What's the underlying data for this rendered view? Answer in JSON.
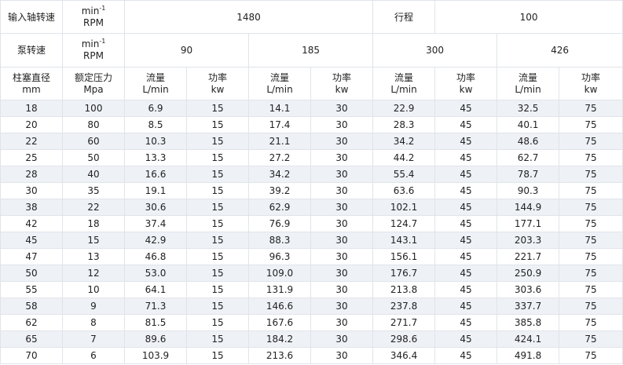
{
  "header": {
    "input_speed_label": "输入轴转速",
    "unit_min": "min",
    "unit_exp": "-1",
    "unit_rpm": "RPM",
    "input_speed_value": "1480",
    "stroke_label": "行程",
    "stroke_value": "100",
    "pump_speed_label": "泵转速",
    "pump_speeds": [
      "90",
      "185",
      "300",
      "426"
    ],
    "plunger_label": "柱塞直径",
    "plunger_unit": "mm",
    "pressure_label": "额定压力",
    "pressure_unit": "Mpa",
    "flow_label": "流量",
    "flow_unit": "L/min",
    "power_label": "功率",
    "power_unit": "kw"
  },
  "rows": [
    [
      "18",
      "100",
      "6.9",
      "15",
      "14.1",
      "30",
      "22.9",
      "45",
      "32.5",
      "75"
    ],
    [
      "20",
      "80",
      "8.5",
      "15",
      "17.4",
      "30",
      "28.3",
      "45",
      "40.1",
      "75"
    ],
    [
      "22",
      "60",
      "10.3",
      "15",
      "21.1",
      "30",
      "34.2",
      "45",
      "48.6",
      "75"
    ],
    [
      "25",
      "50",
      "13.3",
      "15",
      "27.2",
      "30",
      "44.2",
      "45",
      "62.7",
      "75"
    ],
    [
      "28",
      "40",
      "16.6",
      "15",
      "34.2",
      "30",
      "55.4",
      "45",
      "78.7",
      "75"
    ],
    [
      "30",
      "35",
      "19.1",
      "15",
      "39.2",
      "30",
      "63.6",
      "45",
      "90.3",
      "75"
    ],
    [
      "38",
      "22",
      "30.6",
      "15",
      "62.9",
      "30",
      "102.1",
      "45",
      "144.9",
      "75"
    ],
    [
      "42",
      "18",
      "37.4",
      "15",
      "76.9",
      "30",
      "124.7",
      "45",
      "177.1",
      "75"
    ],
    [
      "45",
      "15",
      "42.9",
      "15",
      "88.3",
      "30",
      "143.1",
      "45",
      "203.3",
      "75"
    ],
    [
      "47",
      "13",
      "46.8",
      "15",
      "96.3",
      "30",
      "156.1",
      "45",
      "221.7",
      "75"
    ],
    [
      "50",
      "12",
      "53.0",
      "15",
      "109.0",
      "30",
      "176.7",
      "45",
      "250.9",
      "75"
    ],
    [
      "55",
      "10",
      "64.1",
      "15",
      "131.9",
      "30",
      "213.8",
      "45",
      "303.6",
      "75"
    ],
    [
      "58",
      "9",
      "71.3",
      "15",
      "146.6",
      "30",
      "237.8",
      "45",
      "337.7",
      "75"
    ],
    [
      "62",
      "8",
      "81.5",
      "15",
      "167.6",
      "30",
      "271.7",
      "45",
      "385.8",
      "75"
    ],
    [
      "65",
      "7",
      "89.6",
      "15",
      "184.2",
      "30",
      "298.6",
      "45",
      "424.1",
      "75"
    ],
    [
      "70",
      "6",
      "103.9",
      "15",
      "213.6",
      "30",
      "346.4",
      "45",
      "491.8",
      "75"
    ]
  ]
}
